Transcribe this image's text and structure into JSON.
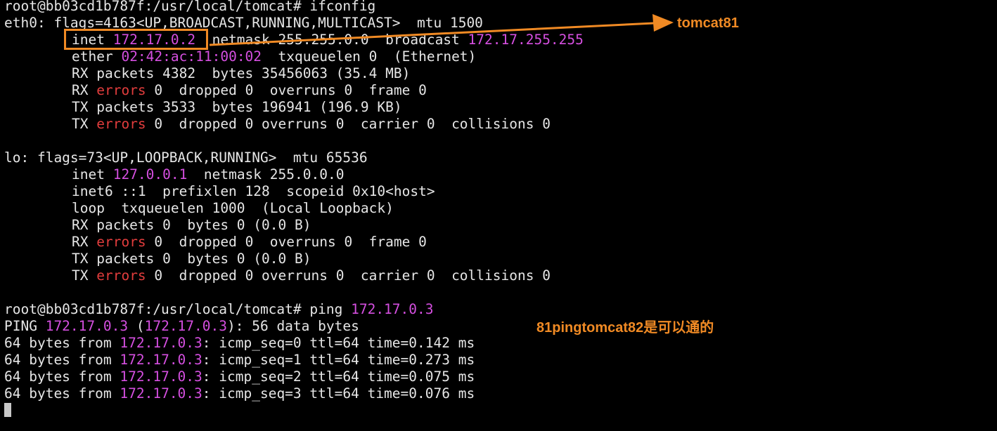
{
  "colors": {
    "background": "#000000",
    "text": "#e6e6e6",
    "highlight_ip": "#d54fe0",
    "errors": "#e23d3d",
    "annotation": "#f08a24"
  },
  "terminal": {
    "l01": {
      "a": "root@bb03cd1b787f:/usr/local/tomcat# ifconfig"
    },
    "l02": {
      "a": "eth0: flags=4163<UP,BROADCAST,RUNNING,MULTICAST>  mtu 1500"
    },
    "l03": {
      "a": "inet ",
      "b": "172.17.0.2",
      "c": "  netmask 255.255.0.0  broadcast ",
      "d": "172.17.255.255"
    },
    "l04": {
      "a": "ether ",
      "b": "02:42:ac:11:00:02",
      "c": "  txqueuelen 0  (Ethernet)"
    },
    "l05": {
      "a": "RX packets 4382  bytes 35456063 (35.4 MB)"
    },
    "l06": {
      "a": "RX ",
      "b": "errors",
      "c": " 0  dropped 0  overruns 0  frame 0"
    },
    "l07": {
      "a": "TX packets 3533  bytes 196941 (196.9 KB)"
    },
    "l08": {
      "a": "TX ",
      "b": "errors",
      "c": " 0  dropped 0 overruns 0  carrier 0  collisions 0"
    },
    "l10": {
      "a": "lo: flags=73<UP,LOOPBACK,RUNNING>  mtu 65536"
    },
    "l11": {
      "a": "inet ",
      "b": "127.0.0.1",
      "c": "  netmask 255.0.0.0"
    },
    "l12": {
      "a": "inet6 ::1  prefixlen 128  scopeid 0x10<host>"
    },
    "l13": {
      "a": "loop  txqueuelen 1000  (Local Loopback)"
    },
    "l14": {
      "a": "RX packets 0  bytes 0 (0.0 B)"
    },
    "l15": {
      "a": "RX ",
      "b": "errors",
      "c": " 0  dropped 0  overruns 0  frame 0"
    },
    "l16": {
      "a": "TX packets 0  bytes 0 (0.0 B)"
    },
    "l17": {
      "a": "TX ",
      "b": "errors",
      "c": " 0  dropped 0 overruns 0  carrier 0  collisions 0"
    },
    "l19": {
      "a": "root@bb03cd1b787f:/usr/local/tomcat# ping ",
      "b": "172.17.0.3"
    },
    "l20": {
      "a": "PING ",
      "b": "172.17.0.3",
      "c": " (",
      "d": "172.17.0.3",
      "e": "): 56 data bytes"
    },
    "l21": {
      "a": "64 bytes from ",
      "b": "172.17.0.3",
      "c": ": icmp_seq=0 ttl=64 time=0.142 ms"
    },
    "l22": {
      "a": "64 bytes from ",
      "b": "172.17.0.3",
      "c": ": icmp_seq=1 ttl=64 time=0.273 ms"
    },
    "l23": {
      "a": "64 bytes from ",
      "b": "172.17.0.3",
      "c": ": icmp_seq=2 ttl=64 time=0.075 ms"
    },
    "l24": {
      "a": "64 bytes from ",
      "b": "172.17.0.3",
      "c": ": icmp_seq=3 ttl=64 time=0.076 ms"
    }
  },
  "annotations": {
    "arrow_label": "tomcat81",
    "ping_note": "81pingtomcat82是可以通的"
  }
}
